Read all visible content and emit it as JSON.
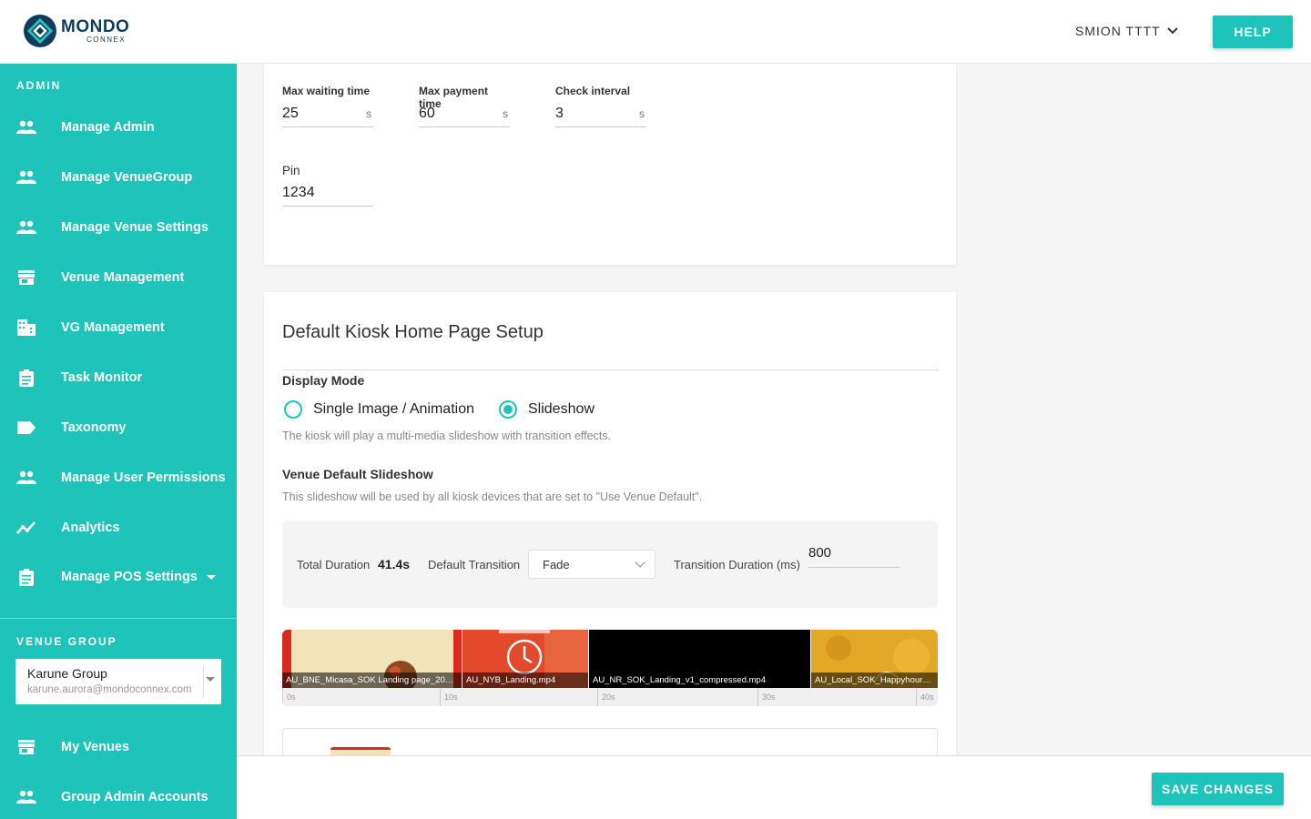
{
  "header": {
    "logo_main": "MONDO",
    "logo_sub": "CONNEX",
    "user_name": "SMION TTTT",
    "help_label": "HELP"
  },
  "sidebar": {
    "admin_section_label": "ADMIN",
    "admin_items": [
      {
        "label": "Manage Admin",
        "icon": "people-icon"
      },
      {
        "label": "Manage VenueGroup",
        "icon": "people-icon"
      },
      {
        "label": "Manage Venue Settings",
        "icon": "people-icon"
      },
      {
        "label": "Venue Management",
        "icon": "store-icon"
      },
      {
        "label": "VG Management",
        "icon": "building-icon"
      },
      {
        "label": "Task Monitor",
        "icon": "clipboard-icon"
      },
      {
        "label": "Taxonomy",
        "icon": "label-icon"
      },
      {
        "label": "Manage User Permissions",
        "icon": "people-icon"
      },
      {
        "label": "Analytics",
        "icon": "analytics-icon"
      },
      {
        "label": "Manage POS Settings",
        "icon": "clipboard-icon"
      }
    ],
    "venue_group_section_label": "VENUE GROUP",
    "venue_group": {
      "name": "Karune Group",
      "email": "karune.aurora@mondoconnex.com"
    },
    "group_items": [
      {
        "label": "My Venues",
        "icon": "store-icon"
      },
      {
        "label": "Group Admin Accounts",
        "icon": "people-icon"
      }
    ]
  },
  "payment_settings": {
    "max_waiting_label": "Max waiting time",
    "max_waiting_value": "25",
    "max_payment_label": "Max payment time",
    "max_payment_value": "60",
    "check_interval_label": "Check interval",
    "check_interval_value": "3",
    "unit": "s",
    "pin_label": "Pin",
    "pin_value": "1234"
  },
  "kiosk": {
    "title": "Default Kiosk Home Page Setup",
    "display_mode_label": "Display Mode",
    "option_single": "Single Image / Animation",
    "option_slideshow": "Slideshow",
    "selected_option": "Slideshow",
    "slideshow_helper": "The kiosk will play a multi-media slideshow with transition effects.",
    "venue_default_label": "Venue Default Slideshow",
    "venue_default_helper": "This slideshow will be used by all kiosk devices that are set to \"Use Venue Default\".",
    "total_duration_label": "Total Duration",
    "total_duration_value": "41.4s",
    "default_transition_label": "Default Transition",
    "default_transition_value": "Fade",
    "transition_duration_label": "Transition Duration (ms)",
    "transition_duration_value": "800",
    "clips": [
      {
        "name": "AU_BNE_Micasa_SOK Landing page_2023...",
        "color": "#f3e3b8"
      },
      {
        "name": "AU_NYB_Landing.mp4",
        "color": "#e34a2b"
      },
      {
        "name": "AU_NR_SOK_Landing_v1_compressed.mp4",
        "color": "#000000"
      },
      {
        "name": "AU_Local_SOK_Happyhour_...",
        "color": "#e3a826"
      }
    ],
    "ticks": [
      "0s",
      "10s",
      "20s",
      "30s",
      "40s"
    ]
  },
  "footer": {
    "save_label": "SAVE CHANGES"
  },
  "colors": {
    "accent": "#1ec3b9",
    "brand_dark": "#123a5c"
  }
}
